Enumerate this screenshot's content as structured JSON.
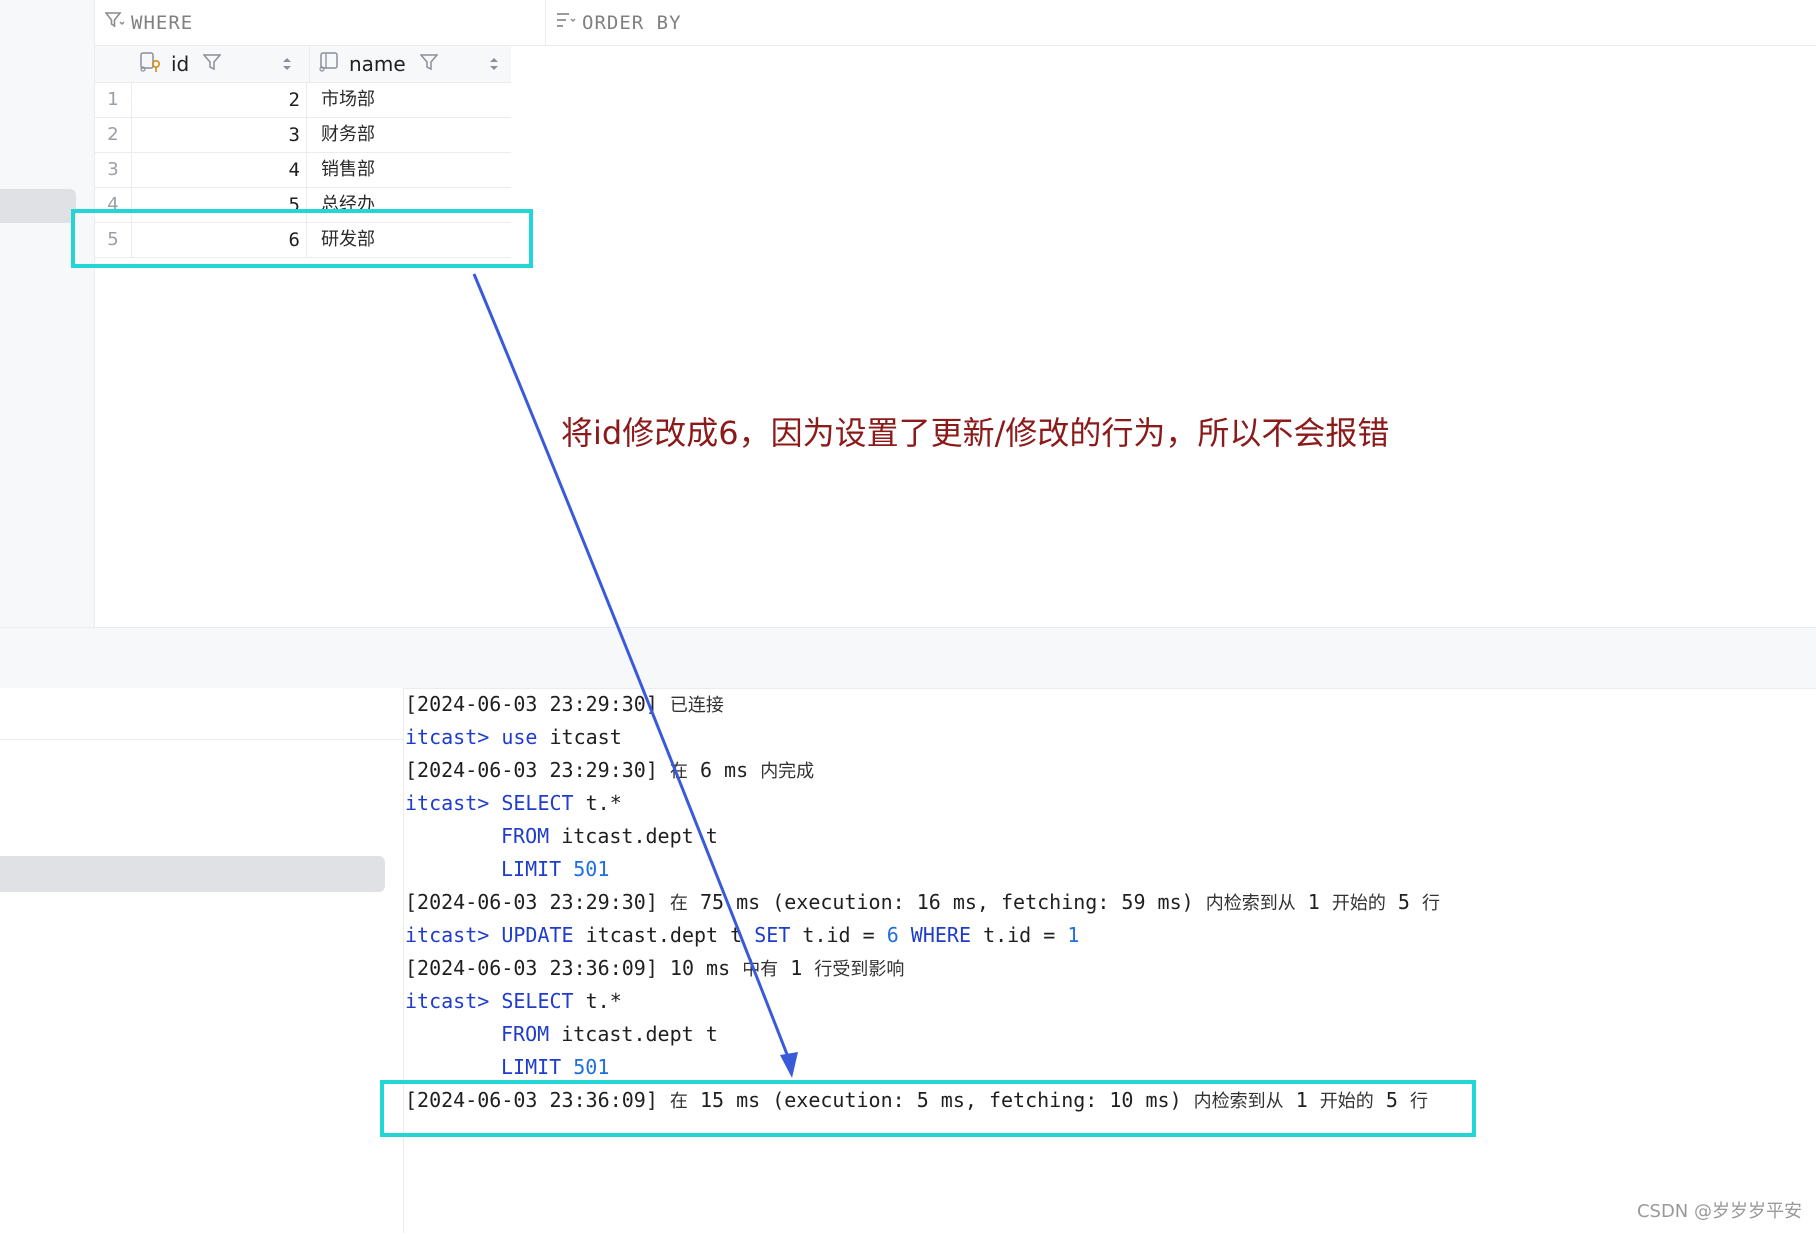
{
  "filter_bar": {
    "where_label": "WHERE",
    "orderby_label": "ORDER BY",
    "where_icon": "filter-icon",
    "orderby_icon": "sort-lines-icon"
  },
  "grid": {
    "columns": [
      {
        "name": "id",
        "icon": "key-column-icon"
      },
      {
        "name": "name",
        "icon": "column-icon"
      }
    ],
    "rows": [
      {
        "num": "1",
        "id": "2",
        "name": "市场部"
      },
      {
        "num": "2",
        "id": "3",
        "name": "财务部"
      },
      {
        "num": "3",
        "id": "4",
        "name": "销售部"
      },
      {
        "num": "4",
        "id": "5",
        "name": "总经办"
      },
      {
        "num": "5",
        "id": "6",
        "name": "研发部"
      }
    ]
  },
  "console": {
    "l1_ts": "[2024-06-03 23:29:30]",
    "l1_msg": "已连接",
    "prompt": "itcast>",
    "l2_kw": "use",
    "l2_rest": "itcast",
    "l3_ts": "[2024-06-03 23:29:30]",
    "l3_zai": "在",
    "l3_ms": "6 ms",
    "l3_msg": "内完成",
    "select_kw": "SELECT",
    "select_rest": "t.*",
    "from_kw": "FROM",
    "from_rest": "itcast.dept t",
    "limit_kw": "LIMIT",
    "limit_num": "501",
    "l7_ts": "[2024-06-03 23:29:30]",
    "l7_zai": "在",
    "l7_detail": "75 ms (execution: 16 ms, fetching: 59 ms)",
    "l7_msg1": "内检索到从",
    "l7_n1": "1",
    "l7_msg2": "开始的",
    "l7_n2": "5",
    "l7_msg3": "行",
    "update_kw": "UPDATE",
    "update_tbl": "itcast.dept t",
    "set_kw": "SET",
    "set_col": "t.id =",
    "set_val": "6",
    "where_kw": "WHERE",
    "where_col": "t.id =",
    "where_val": "1",
    "l9_ts": "[2024-06-03 23:36:09]",
    "l9_ms": "10 ms",
    "l9_msg1": "中有",
    "l9_n": "1",
    "l9_msg2": "行受到影响",
    "l13_ts": "[2024-06-03 23:36:09]",
    "l13_zai": "在",
    "l13_detail": "15 ms (execution: 5 ms, fetching: 10 ms)",
    "l13_msg1": "内检索到从",
    "l13_n1": "1",
    "l13_msg2": "开始的",
    "l13_n2": "5",
    "l13_msg3": "行"
  },
  "annotation": {
    "text": "将id修改成6，因为设置了更新/修改的行为，所以不会报错",
    "highlight_color": "#22d6d6",
    "arrow_color": "#3a5bd9",
    "text_color": "#8b1a1a"
  },
  "watermark": "CSDN @岁岁岁平安"
}
